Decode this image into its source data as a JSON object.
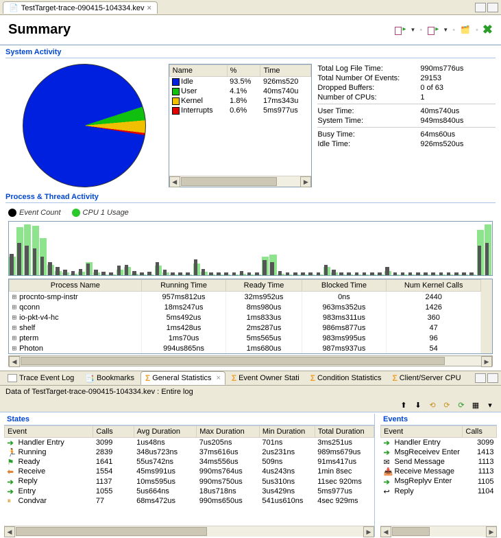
{
  "tab": {
    "title": "TestTarget-trace-090415-104334.kev"
  },
  "header": {
    "title": "Summary"
  },
  "sections": {
    "system_activity": "System Activity",
    "process_thread": "Process & Thread Activity",
    "states": "States",
    "events": "Events"
  },
  "pie_headers": {
    "name": "Name",
    "pct": "%",
    "time": "Time"
  },
  "pie_rows": [
    {
      "name": "Idle",
      "pct": "93.5%",
      "time": "926ms520",
      "color": "#0020e0"
    },
    {
      "name": "User",
      "pct": "4.1%",
      "time": "40ms740u",
      "color": "#10c010"
    },
    {
      "name": "Kernel",
      "pct": "1.8%",
      "time": "17ms343u",
      "color": "#f0c000"
    },
    {
      "name": "Interrupts",
      "pct": "0.6%",
      "time": "5ms977us",
      "color": "#e00000"
    }
  ],
  "stats": [
    {
      "label": "Total Log File Time:",
      "value": "990ms776us"
    },
    {
      "label": "Total Number Of Events:",
      "value": "29153"
    },
    {
      "label": "Dropped Buffers:",
      "value": "0 of 63"
    },
    {
      "label": "Number of CPUs:",
      "value": "1"
    }
  ],
  "stats2": [
    {
      "label": "User Time:",
      "value": "40ms740us"
    },
    {
      "label": "System Time:",
      "value": "949ms840us"
    }
  ],
  "stats3": [
    {
      "label": "Busy Time:",
      "value": "64ms60us"
    },
    {
      "label": "Idle Time:",
      "value": "926ms520us"
    }
  ],
  "legend": {
    "event_count": "Event Count",
    "cpu1": "CPU 1 Usage"
  },
  "proc_headers": {
    "name": "Process Name",
    "running": "Running Time",
    "ready": "Ready Time",
    "blocked": "Blocked Time",
    "kernel": "Num Kernel Calls"
  },
  "proc_rows": [
    {
      "name": "procnto-smp-instr",
      "running": "957ms812us",
      "ready": "32ms952us",
      "blocked": "0ns",
      "kernel": "2440"
    },
    {
      "name": "qconn",
      "running": "18ms247us",
      "ready": "8ms980us",
      "blocked": "963ms352us",
      "kernel": "1426"
    },
    {
      "name": "io-pkt-v4-hc",
      "running": "5ms492us",
      "ready": "1ms833us",
      "blocked": "983ms311us",
      "kernel": "360"
    },
    {
      "name": "shelf",
      "running": "1ms428us",
      "ready": "2ms287us",
      "blocked": "986ms877us",
      "kernel": "47"
    },
    {
      "name": "pterm",
      "running": "1ms70us",
      "ready": "5ms565us",
      "blocked": "983ms995us",
      "kernel": "96"
    },
    {
      "name": "Photon",
      "running": "994us865ns",
      "ready": "1ms680us",
      "blocked": "987ms937us",
      "kernel": "54"
    }
  ],
  "view_tabs": {
    "trace": "Trace Event Log",
    "bookmarks": "Bookmarks",
    "general": "General Statistics",
    "owner": "Event Owner Stati",
    "condition": "Condition Statistics",
    "client": "Client/Server CPU"
  },
  "data_label": "Data of TestTarget-trace-090415-104334.kev : Entire log",
  "states_headers": {
    "event": "Event",
    "calls": "Calls",
    "avg": "Avg Duration",
    "max": "Max Duration",
    "min": "Min Duration",
    "total": "Total Duration"
  },
  "states_rows": [
    {
      "icon": "r",
      "event": "Handler Entry",
      "calls": "3099",
      "avg": "1us48ns",
      "max": "7us205ns",
      "min": "701ns",
      "total": "3ms251us"
    },
    {
      "icon": "run",
      "event": "Running",
      "calls": "2839",
      "avg": "348us723ns",
      "max": "37ms616us",
      "min": "2us231ns",
      "total": "989ms679us"
    },
    {
      "icon": "ready",
      "event": "Ready",
      "calls": "1641",
      "avg": "55us742ns",
      "max": "34ms556us",
      "min": "509ns",
      "total": "91ms417us"
    },
    {
      "icon": "l",
      "event": "Receive",
      "calls": "1554",
      "avg": "45ms991us",
      "max": "990ms764us",
      "min": "4us243ns",
      "total": "1min 8sec"
    },
    {
      "icon": "r",
      "event": "Reply",
      "calls": "1137",
      "avg": "10ms595us",
      "max": "990ms750us",
      "min": "5us310ns",
      "total": "11sec 920ms"
    },
    {
      "icon": "r",
      "event": "Entry",
      "calls": "1055",
      "avg": "5us664ns",
      "max": "18us718ns",
      "min": "3us429ns",
      "total": "5ms977us"
    },
    {
      "icon": "cv",
      "event": "Condvar",
      "calls": "77",
      "avg": "68ms472us",
      "max": "990ms650us",
      "min": "541us610ns",
      "total": "4sec 929ms"
    }
  ],
  "events_headers": {
    "event": "Event",
    "calls": "Calls"
  },
  "events_rows": [
    {
      "icon": "r",
      "event": "Handler Entry",
      "calls": "3099"
    },
    {
      "icon": "r",
      "event": "MsgReceivev Enter",
      "calls": "1413"
    },
    {
      "icon": "send",
      "event": "Send Message",
      "calls": "1113"
    },
    {
      "icon": "recv",
      "event": "Receive Message",
      "calls": "1113"
    },
    {
      "icon": "r",
      "event": "MsgReplyv Enter",
      "calls": "1105"
    },
    {
      "icon": "reply",
      "event": "Reply",
      "calls": "1104"
    }
  ],
  "chart_data": {
    "type": "bar",
    "title": "",
    "series": [
      {
        "name": "Event Count",
        "color": "#555"
      },
      {
        "name": "CPU 1 Usage",
        "color": "#5cd85c"
      }
    ],
    "note": "Sampled time buckets; values estimated from pixel heights (0-100 scale)",
    "samples": [
      {
        "ev": 40,
        "cpu": 35
      },
      {
        "ev": 60,
        "cpu": 90
      },
      {
        "ev": 55,
        "cpu": 95
      },
      {
        "ev": 50,
        "cpu": 92
      },
      {
        "ev": 35,
        "cpu": 70
      },
      {
        "ev": 25,
        "cpu": 20
      },
      {
        "ev": 15,
        "cpu": 8
      },
      {
        "ev": 10,
        "cpu": 5
      },
      {
        "ev": 8,
        "cpu": 3
      },
      {
        "ev": 12,
        "cpu": 6
      },
      {
        "ev": 22,
        "cpu": 25
      },
      {
        "ev": 10,
        "cpu": 5
      },
      {
        "ev": 6,
        "cpu": 2
      },
      {
        "ev": 5,
        "cpu": 2
      },
      {
        "ev": 18,
        "cpu": 10
      },
      {
        "ev": 20,
        "cpu": 15
      },
      {
        "ev": 8,
        "cpu": 3
      },
      {
        "ev": 5,
        "cpu": 2
      },
      {
        "ev": 6,
        "cpu": 2
      },
      {
        "ev": 25,
        "cpu": 18
      },
      {
        "ev": 10,
        "cpu": 5
      },
      {
        "ev": 5,
        "cpu": 2
      },
      {
        "ev": 5,
        "cpu": 2
      },
      {
        "ev": 5,
        "cpu": 2
      },
      {
        "ev": 30,
        "cpu": 22
      },
      {
        "ev": 12,
        "cpu": 6
      },
      {
        "ev": 5,
        "cpu": 2
      },
      {
        "ev": 5,
        "cpu": 2
      },
      {
        "ev": 5,
        "cpu": 2
      },
      {
        "ev": 5,
        "cpu": 2
      },
      {
        "ev": 8,
        "cpu": 3
      },
      {
        "ev": 5,
        "cpu": 2
      },
      {
        "ev": 5,
        "cpu": 2
      },
      {
        "ev": 28,
        "cpu": 35
      },
      {
        "ev": 25,
        "cpu": 38
      },
      {
        "ev": 8,
        "cpu": 3
      },
      {
        "ev": 5,
        "cpu": 2
      },
      {
        "ev": 5,
        "cpu": 2
      },
      {
        "ev": 5,
        "cpu": 2
      },
      {
        "ev": 5,
        "cpu": 2
      },
      {
        "ev": 5,
        "cpu": 2
      },
      {
        "ev": 20,
        "cpu": 15
      },
      {
        "ev": 10,
        "cpu": 5
      },
      {
        "ev": 5,
        "cpu": 2
      },
      {
        "ev": 5,
        "cpu": 2
      },
      {
        "ev": 5,
        "cpu": 2
      },
      {
        "ev": 5,
        "cpu": 2
      },
      {
        "ev": 5,
        "cpu": 2
      },
      {
        "ev": 5,
        "cpu": 2
      },
      {
        "ev": 15,
        "cpu": 8
      },
      {
        "ev": 5,
        "cpu": 2
      },
      {
        "ev": 5,
        "cpu": 2
      },
      {
        "ev": 5,
        "cpu": 2
      },
      {
        "ev": 5,
        "cpu": 2
      },
      {
        "ev": 5,
        "cpu": 2
      },
      {
        "ev": 5,
        "cpu": 2
      },
      {
        "ev": 5,
        "cpu": 2
      },
      {
        "ev": 5,
        "cpu": 2
      },
      {
        "ev": 5,
        "cpu": 2
      },
      {
        "ev": 5,
        "cpu": 2
      },
      {
        "ev": 5,
        "cpu": 2
      },
      {
        "ev": 55,
        "cpu": 85
      },
      {
        "ev": 60,
        "cpu": 95
      }
    ]
  }
}
